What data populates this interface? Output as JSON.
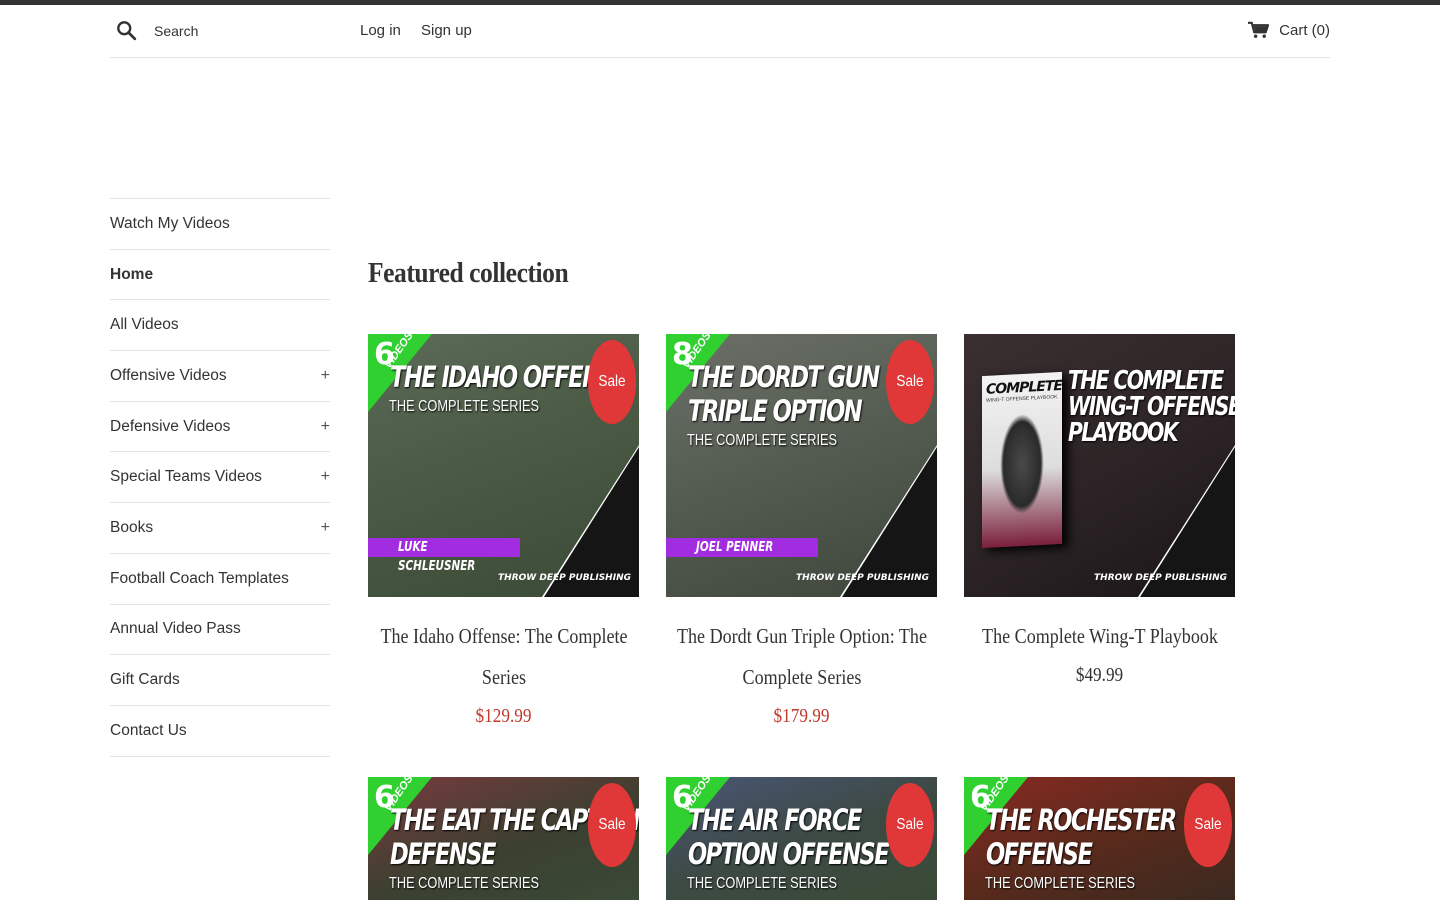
{
  "header": {
    "search_placeholder": "Search",
    "login_label": "Log in",
    "signup_label": "Sign up",
    "cart_label": "Cart (0)"
  },
  "sidebar": {
    "items": [
      {
        "label": "Watch My Videos",
        "expandable": false
      },
      {
        "label": "Home",
        "expandable": false,
        "active": true
      },
      {
        "label": "All Videos",
        "expandable": false
      },
      {
        "label": "Offensive Videos",
        "expandable": true
      },
      {
        "label": "Defensive Videos",
        "expandable": true
      },
      {
        "label": "Special Teams Videos",
        "expandable": true
      },
      {
        "label": "Books",
        "expandable": true
      },
      {
        "label": "Football Coach Templates",
        "expandable": false
      },
      {
        "label": "Annual Video Pass",
        "expandable": false
      },
      {
        "label": "Gift Cards",
        "expandable": false
      },
      {
        "label": "Contact Us",
        "expandable": false
      }
    ],
    "expand_symbol": "+"
  },
  "main": {
    "section_title": "Featured collection",
    "sale_badge": "Sale",
    "publisher": "THROW DEEP PUBLISHING",
    "products": [
      {
        "title": "The Idaho Offense: The Complete Series",
        "price": "$129.99",
        "on_sale": true,
        "thumb_count": "6",
        "thumb_videos": "VIDEOS",
        "thumb_title": "THE IDAHO OFFENSE",
        "thumb_sub": "THE COMPLETE SERIES",
        "thumb_coach": "LUKE SCHLEUSNER"
      },
      {
        "title": "The Dordt Gun Triple Option: The Complete Series",
        "price": "$179.99",
        "on_sale": true,
        "thumb_count": "8",
        "thumb_videos": "VIDEOS",
        "thumb_title": "THE DORDT GUN",
        "thumb_title2": "TRIPLE OPTION",
        "thumb_sub": "THE COMPLETE SERIES",
        "thumb_coach": "JOEL PENNER"
      },
      {
        "title": "The Complete Wing-T Playbook",
        "price": "$49.99",
        "on_sale": false,
        "thumb_title": "THE COMPLETE",
        "thumb_title2": "WING-T OFFENSE",
        "thumb_title3": "PLAYBOOK",
        "book_cover": "COMPLETE",
        "book_cover_sub": "WING-T OFFENSE PLAYBOOK"
      },
      {
        "thumb_count": "6",
        "thumb_videos": "VIDEOS",
        "thumb_title": "THE EAT THE CAPTAIN",
        "thumb_title2": "DEFENSE",
        "thumb_sub": "THE COMPLETE SERIES",
        "on_sale": true
      },
      {
        "thumb_count": "6",
        "thumb_videos": "VIDEOS",
        "thumb_title": "THE AIR FORCE",
        "thumb_title2": "OPTION OFFENSE",
        "thumb_sub": "THE COMPLETE SERIES",
        "on_sale": true
      },
      {
        "thumb_count": "6",
        "thumb_videos": "VIDEOS",
        "thumb_title": "THE ROCHESTER",
        "thumb_title2": "OFFENSE",
        "thumb_sub": "THE COMPLETE SERIES",
        "on_sale": true
      }
    ]
  },
  "colors": {
    "topbar": "#333333",
    "sale_badge": "#e03838",
    "sale_price": "#c0392b",
    "ribbon": "#2fd02f",
    "coach_bar": "#a12ce0"
  },
  "icons": {
    "search": "search-icon",
    "cart": "cart-icon",
    "expand": "plus-icon"
  }
}
